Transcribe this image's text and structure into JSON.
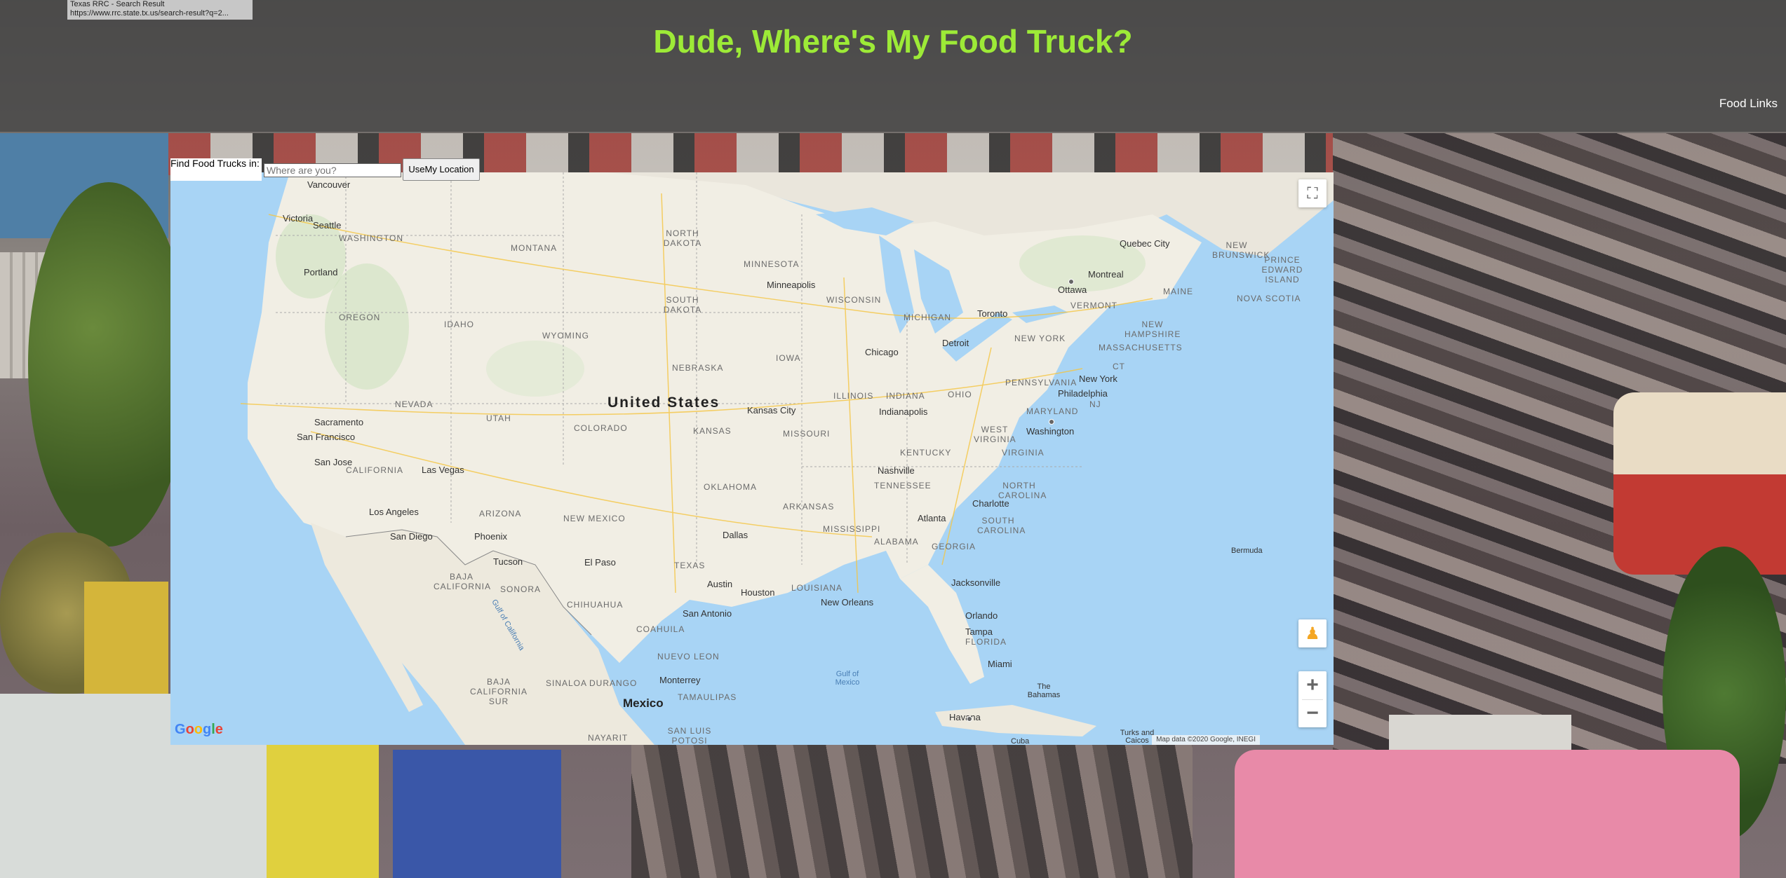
{
  "tooltip": {
    "title": "Texas RRC - Search Result",
    "url": "https://www.rrc.state.tx.us/search-result?q=2..."
  },
  "header": {
    "title": "Dude, Where's My Food Truck?",
    "nav_link": "Food Links"
  },
  "finder": {
    "label": "Find Food Trucks in:",
    "input_placeholder": "Where are you?",
    "input_value": "",
    "button_label": "UseMy Location"
  },
  "map": {
    "country_label": "United States",
    "states": [
      "WASHINGTON",
      "OREGON",
      "IDAHO",
      "MONTANA",
      "NORTH DAKOTA",
      "SOUTH DAKOTA",
      "WYOMING",
      "NEBRASKA",
      "NEVADA",
      "UTAH",
      "COLORADO",
      "KANSAS",
      "CALIFORNIA",
      "ARIZONA",
      "NEW MEXICO",
      "OKLAHOMA",
      "TEXAS",
      "MINNESOTA",
      "IOWA",
      "MISSOURI",
      "ARKANSAS",
      "LOUISIANA",
      "WISCONSIN",
      "ILLINOIS",
      "MICHIGAN",
      "INDIANA",
      "OHIO",
      "KENTUCKY",
      "TENNESSEE",
      "MISSISSIPPI",
      "ALABAMA",
      "GEORGIA",
      "FLORIDA",
      "SOUTH CAROLINA",
      "NORTH CAROLINA",
      "VIRGINIA",
      "WEST VIRGINIA",
      "PENNSYLVANIA",
      "NEW YORK",
      "MARYLAND",
      "NJ",
      "CT",
      "MASSACHUSETTS",
      "VERMONT",
      "NEW HAMPSHIRE",
      "MAINE",
      "NEW BRUNSWICK",
      "NOVA SCOTIA",
      "PRINCE EDWARD ISLAND",
      "SONORA",
      "CHIHUAHUA",
      "COAHUILA",
      "BAJA CALIFORNIA",
      "BAJA CALIFORNIA SUR",
      "SINALOA",
      "DURANGO",
      "NUEVO LEON",
      "TAMAULIPAS",
      "NAYARIT",
      "SAN LUIS POTOSI"
    ],
    "cities": [
      "Vancouver",
      "Victoria",
      "Seattle",
      "Portland",
      "Sacramento",
      "San Francisco",
      "San Jose",
      "Las Vegas",
      "Los Angeles",
      "San Diego",
      "Phoenix",
      "Tucson",
      "El Paso",
      "Minneapolis",
      "Kansas City",
      "Dallas",
      "Austin",
      "San Antonio",
      "Houston",
      "New Orleans",
      "Chicago",
      "Detroit",
      "Indianapolis",
      "Nashville",
      "Atlanta",
      "Charlotte",
      "Washington",
      "Philadelphia",
      "New York",
      "Toronto",
      "Ottawa",
      "Montreal",
      "Quebec City",
      "Jacksonville",
      "Orlando",
      "Tampa",
      "Miami",
      "Monterrey",
      "Bermuda",
      "Havana",
      "The Bahamas",
      "Turks and Caicos",
      "Mexico",
      "Cuba"
    ],
    "water": [
      "Gulf of California",
      "Gulf of Mexico"
    ],
    "attribution": "Map data ©2020 Google, INEGI",
    "logo": "Google",
    "zoom_in": "+",
    "zoom_out": "−",
    "fullscreen_icon": "fullscreen-icon",
    "pegman_icon": "pegman-icon"
  }
}
